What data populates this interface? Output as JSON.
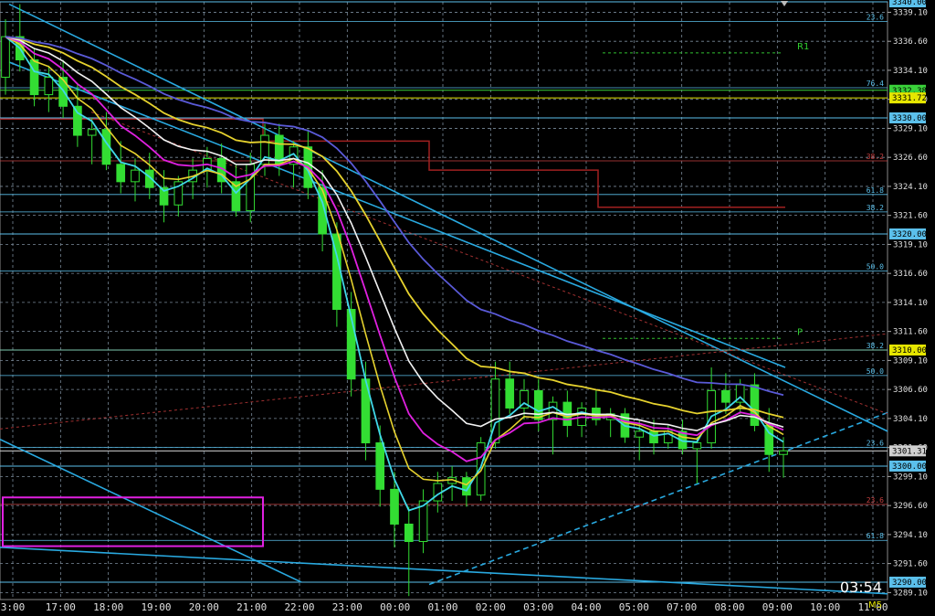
{
  "chart_data": {
    "type": "candlestick",
    "timeframe": "M5",
    "ylim": [
      3288.5,
      3340.0
    ],
    "y_ticks": [
      "3339.10",
      "3336.60",
      "3334.10",
      "3331.60",
      "3329.10",
      "3326.60",
      "3324.10",
      "3321.60",
      "3319.10",
      "3316.60",
      "3314.10",
      "3311.60",
      "3309.10",
      "3306.60",
      "3304.10",
      "3301.60",
      "3299.10",
      "3296.60",
      "3294.10",
      "3291.60",
      "3289.10"
    ],
    "x_ticks": [
      "3:00",
      "17:00",
      "18:00",
      "19:00",
      "20:00",
      "21:00",
      "22:00",
      "23:00",
      "00:00",
      "01:00",
      "02:00",
      "03:00",
      "04:00",
      "05:00",
      "07:00",
      "08:00",
      "09:00",
      "10:00",
      "11:00"
    ],
    "price_boxes": [
      {
        "label": "3340.00",
        "value": 3340.0,
        "color": "#5bc0eb",
        "text": "#000000"
      },
      {
        "label": "3332.38",
        "value": 3332.38,
        "color": "#3ad23a",
        "text": "#000000"
      },
      {
        "label": "3331.72",
        "value": 3331.72,
        "color": "#e6e600",
        "text": "#000000"
      },
      {
        "label": "3330.00",
        "value": 3330.0,
        "color": "#5bc0eb",
        "text": "#000000"
      },
      {
        "label": "3320.00",
        "value": 3320.0,
        "color": "#5bc0eb",
        "text": "#000000"
      },
      {
        "label": "3310.00",
        "value": 3310.0,
        "color": "#e6e600",
        "text": "#000000"
      },
      {
        "label": "3301.31",
        "value": 3301.31,
        "color": "#d0d0d0",
        "text": "#000000"
      },
      {
        "label": "3300.00",
        "value": 3300.0,
        "color": "#5bc0eb",
        "text": "#000000"
      },
      {
        "label": "3290.00",
        "value": 3290.0,
        "color": "#5bc0eb",
        "text": "#000000"
      }
    ],
    "fib_levels": [
      {
        "label": "23.6",
        "value": 3338.3,
        "color": "#5bc0eb"
      },
      {
        "label": "76.4",
        "value": 3332.6,
        "color": "#5bc0eb"
      },
      {
        "label": "38.2",
        "value": 3326.3,
        "color": "#c84040"
      },
      {
        "label": "61.8",
        "value": 3323.4,
        "color": "#5bc0eb"
      },
      {
        "label": "38.2",
        "value": 3321.9,
        "color": "#5bc0eb"
      },
      {
        "label": "50.0",
        "value": 3316.8,
        "color": "#5bc0eb"
      },
      {
        "label": "38.2",
        "value": 3310.0,
        "color": "#5bc0eb"
      },
      {
        "label": "50.0",
        "value": 3307.8,
        "color": "#5bc0eb"
      },
      {
        "label": "23.6",
        "value": 3301.6,
        "color": "#5bc0eb"
      },
      {
        "label": "23.6",
        "value": 3296.7,
        "color": "#c84040"
      },
      {
        "label": "61.8",
        "value": 3293.6,
        "color": "#5bc0eb"
      }
    ],
    "pivots": [
      {
        "label": "R1",
        "value": 3335.6
      },
      {
        "label": "P",
        "value": 3311.0
      }
    ],
    "candles": [
      [
        3333.5,
        3338.5,
        3332.0,
        3337.0
      ],
      [
        3337.0,
        3339.8,
        3334.0,
        3335.0
      ],
      [
        3335.0,
        3336.0,
        3331.0,
        3332.0
      ],
      [
        3332.0,
        3334.5,
        3330.5,
        3333.5
      ],
      [
        3333.5,
        3335.0,
        3330.0,
        3331.0
      ],
      [
        3331.0,
        3333.0,
        3327.5,
        3328.5
      ],
      [
        3328.5,
        3330.0,
        3326.0,
        3329.0
      ],
      [
        3329.0,
        3330.5,
        3325.5,
        3326.0
      ],
      [
        3326.0,
        3328.0,
        3323.5,
        3324.5
      ],
      [
        3324.5,
        3326.5,
        3322.8,
        3325.5
      ],
      [
        3325.5,
        3327.0,
        3323.0,
        3324.0
      ],
      [
        3324.0,
        3325.5,
        3321.0,
        3322.5
      ],
      [
        3322.5,
        3325.0,
        3321.5,
        3324.5
      ],
      [
        3324.5,
        3326.5,
        3323.0,
        3325.5
      ],
      [
        3325.5,
        3327.5,
        3324.0,
        3326.5
      ],
      [
        3326.5,
        3327.8,
        3323.5,
        3324.5
      ],
      [
        3324.5,
        3326.0,
        3321.5,
        3322.0
      ],
      [
        3322.0,
        3327.0,
        3321.0,
        3326.0
      ],
      [
        3326.0,
        3329.5,
        3325.0,
        3328.5
      ],
      [
        3328.5,
        3329.5,
        3325.0,
        3326.0
      ],
      [
        3326.0,
        3328.0,
        3324.0,
        3327.5
      ],
      [
        3327.5,
        3329.0,
        3323.0,
        3324.0
      ],
      [
        3324.0,
        3325.5,
        3318.5,
        3320.0
      ],
      [
        3320.0,
        3321.0,
        3312.0,
        3313.5
      ],
      [
        3313.5,
        3315.0,
        3306.0,
        3307.5
      ],
      [
        3307.5,
        3309.0,
        3300.5,
        3302.0
      ],
      [
        3302.0,
        3303.5,
        3296.5,
        3298.0
      ],
      [
        3298.0,
        3299.5,
        3293.0,
        3295.0
      ],
      [
        3295.0,
        3296.5,
        3288.8,
        3293.5
      ],
      [
        3293.5,
        3298.0,
        3292.5,
        3297.0
      ],
      [
        3297.0,
        3299.5,
        3296.0,
        3298.5
      ],
      [
        3298.5,
        3300.0,
        3297.0,
        3299.0
      ],
      [
        3299.0,
        3299.5,
        3296.5,
        3297.5
      ],
      [
        3297.5,
        3302.5,
        3297.0,
        3302.0
      ],
      [
        3302.0,
        3309.0,
        3301.5,
        3307.5
      ],
      [
        3307.5,
        3309.0,
        3304.5,
        3305.0
      ],
      [
        3305.0,
        3307.5,
        3304.0,
        3306.5
      ],
      [
        3306.5,
        3307.5,
        3303.0,
        3304.0
      ],
      [
        3304.0,
        3306.0,
        3301.0,
        3305.5
      ],
      [
        3305.5,
        3306.5,
        3302.5,
        3303.5
      ],
      [
        3303.5,
        3305.5,
        3302.5,
        3305.0
      ],
      [
        3305.0,
        3306.5,
        3303.5,
        3304.0
      ],
      [
        3304.0,
        3305.0,
        3302.5,
        3304.5
      ],
      [
        3304.5,
        3305.0,
        3302.0,
        3302.5
      ],
      [
        3302.5,
        3304.0,
        3300.5,
        3303.0
      ],
      [
        3303.0,
        3304.0,
        3301.0,
        3302.0
      ],
      [
        3302.0,
        3303.5,
        3301.5,
        3303.0
      ],
      [
        3303.0,
        3304.0,
        3301.0,
        3301.5
      ],
      [
        3301.5,
        3302.5,
        3298.5,
        3302.0
      ],
      [
        3302.0,
        3308.5,
        3301.5,
        3306.5
      ],
      [
        3306.5,
        3308.0,
        3304.5,
        3305.5
      ],
      [
        3305.5,
        3307.5,
        3304.5,
        3307.0
      ],
      [
        3307.0,
        3308.0,
        3303.0,
        3303.5
      ],
      [
        3303.5,
        3305.0,
        3299.5,
        3301.0
      ],
      [
        3301.0,
        3302.5,
        3299.0,
        3301.31
      ]
    ]
  },
  "clock": "03:54",
  "period": "M5",
  "colors": {
    "bull": "#33dd33",
    "bear": "#33dd33",
    "grid": "#7a8a9a",
    "ma_white": "#f2f2f2",
    "ma_magenta": "#e020e0",
    "ma_yellow": "#e6d22e",
    "ma_blue": "#5a5ad8",
    "ma_cyan": "#40d8e8",
    "trendline": "#29a9e0",
    "pivot_red": "#a02020",
    "box_magenta": "#e020e0"
  }
}
